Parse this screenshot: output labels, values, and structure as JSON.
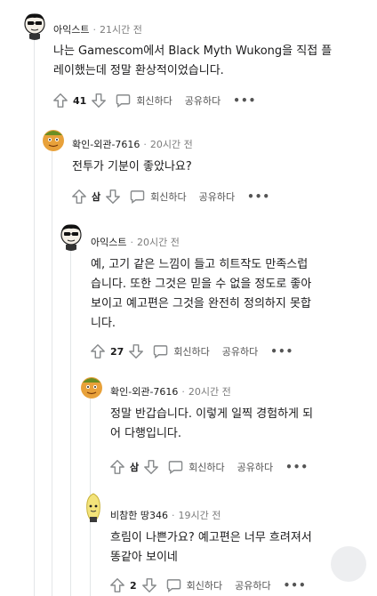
{
  "comments": [
    {
      "author": "아익스트",
      "time": "21시간 전",
      "body": [
        "나는 Gamescom에서 Black Myth Wukong을 직접 플",
        "레이했는데 정말 환상적이었습니다."
      ],
      "votes": "41",
      "reply_label": "회신하다",
      "share_label": "공유하다",
      "more_label": "•••"
    },
    {
      "author": "확인-외관-7616",
      "time": "20시간 전",
      "body": [
        "전투가 기분이 좋았나요?"
      ],
      "votes": "삼",
      "reply_label": "회신하다",
      "share_label": "공유하다",
      "more_label": "•••"
    },
    {
      "author": "아익스트",
      "time": "20시간 전",
      "body": [
        "예, 고기 같은 느낌이 들고 히트작도 만족스럽",
        "습니다. 또한 그것은 믿을 수 없을 정도로 좋아",
        "보이고 예고편은 그것을 완전히 정의하지 못합",
        "니다."
      ],
      "votes": "27",
      "reply_label": "회신하다",
      "share_label": "공유하다",
      "more_label": "•••"
    },
    {
      "author": "확인-외관-7616",
      "time": "20시간 전",
      "body": [
        "정말 반갑습니다. 이렇게 일찍 경험하게 되",
        "어 다행입니다."
      ],
      "votes": "삼",
      "reply_label": "회신하다",
      "share_label": "공유하다",
      "more_label": "•••"
    },
    {
      "author": "비참한 땅346",
      "time": "19시간 전",
      "body": [
        "흐림이 나쁜가요? 예고편은 너무 흐려져서",
        "똥같아 보이네"
      ],
      "votes": "2",
      "reply_label": "회신하다",
      "share_label": "공유하다",
      "more_label": "•••"
    }
  ],
  "icons": {
    "upvote": "up-arrow-icon",
    "downvote": "down-arrow-icon",
    "reply": "speech-bubble-icon"
  },
  "colors": {
    "text": "#1a1a1b",
    "meta": "#7c7c7c",
    "icon": "#878a8c",
    "thread_line": "#e3e6e8"
  }
}
